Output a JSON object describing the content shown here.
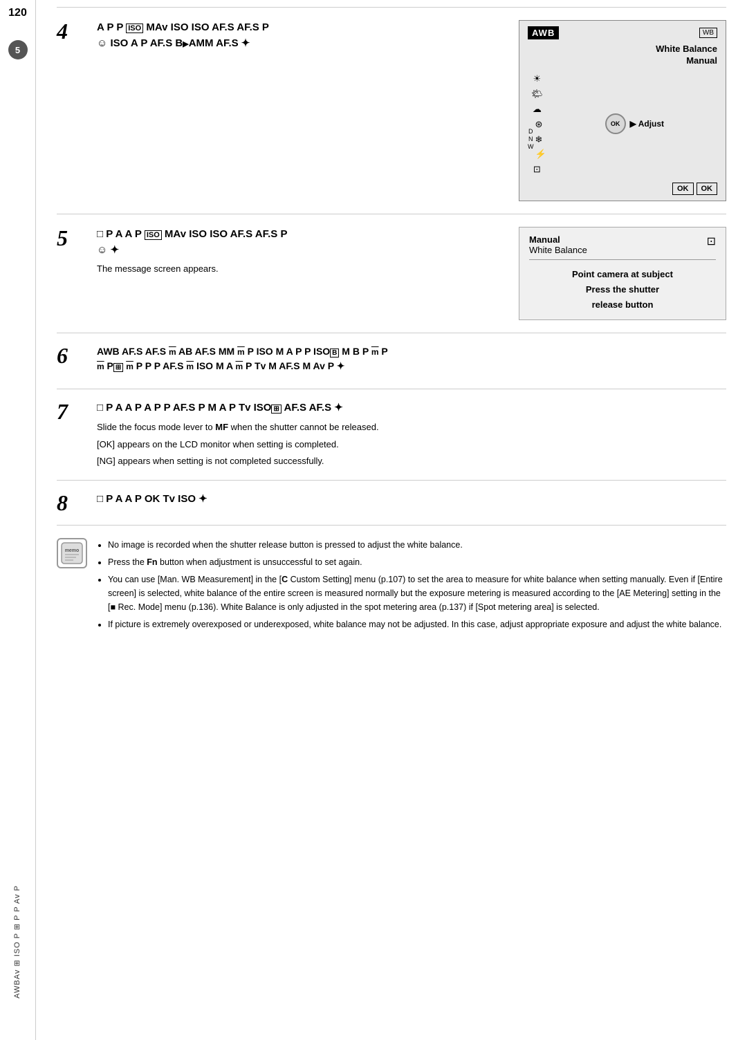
{
  "page": {
    "number": "120",
    "sidebar_text": "AWBAv ⊞ ISO P ⊞ P P Av P"
  },
  "step4": {
    "number": "4",
    "title": "A P P ⊞ISO MAv ISO ISO AF.S AF.S P ☺ ISO A P AF.S B▶AMM AF.S ✦",
    "camera_ui": {
      "awb": "AWB",
      "wb": "WB",
      "white_balance_label": "White Balance",
      "manual_label": "Manual",
      "icons": [
        "☀",
        "▲",
        "☁",
        "▪",
        "⊛",
        "❄",
        "⚡",
        "⊡"
      ],
      "dnw": "D\nN\nW",
      "ok_label": "OK",
      "adjust_label": "▶ Adjust",
      "ok_btn1": "OK",
      "ok_btn2": "OK"
    }
  },
  "step5": {
    "number": "5",
    "title": "□ P A A P ⊞ISO MAv ISO ISO AF.S AF.S P ☺ ✦",
    "body": "The message screen appears.",
    "manual_wb": {
      "title_line1": "Manual",
      "title_line2": "White Balance",
      "icon": "⊡",
      "body_line1": "Point camera at subject",
      "body_line2": "Press the shutter",
      "body_line3": "release button"
    }
  },
  "step6": {
    "number": "6",
    "title": "AWB AF.S AF.S ⊞ AB AF.S MM ⊞ P ISO M A P P ISO⊞ B M B P ⊞ P ⊞ P⊞ ⊞ P P P AF.S ⊞ ISO M A ⊞ P Tv M AF.S M Av P ✦"
  },
  "step7": {
    "number": "7",
    "title": "□ P A A P A P P AF.S P M A P Tv ISO⊞ AF.S AF.S ✦",
    "body_lines": [
      "Slide the focus mode lever to MF when the shutter cannot be released.",
      "[OK] appears on the LCD monitor when setting is completed.",
      "[NG] appears when setting is not completed successfully."
    ],
    "mf_bold": "MF"
  },
  "step8": {
    "number": "8",
    "title": "□ P A A P OK Tv ISO ✦"
  },
  "memo": {
    "icon_label": "memo",
    "bullets": [
      "No image is recorded when the shutter release button is pressed to adjust the white balance.",
      "Press the Fn button when adjustment is unsuccessful to set again.",
      "You can use [Man. WB Measurement] in the [C Custom Setting] menu (p.107) to set the area to measure for white balance when setting manually. Even if [Entire screen] is selected, white balance of the entire screen is measured normally but the exposure metering is measured according to the [AE Metering] setting in the [■ Rec. Mode] menu (p.136). White Balance is only adjusted in the spot metering area (p.137) if [Spot metering area] is selected.",
      "If picture is extremely overexposed or underexposed, white balance may not be adjusted. In this case, adjust appropriate exposure and adjust the white balance."
    ],
    "fn_bold": "Fn",
    "c_bold": "C"
  }
}
